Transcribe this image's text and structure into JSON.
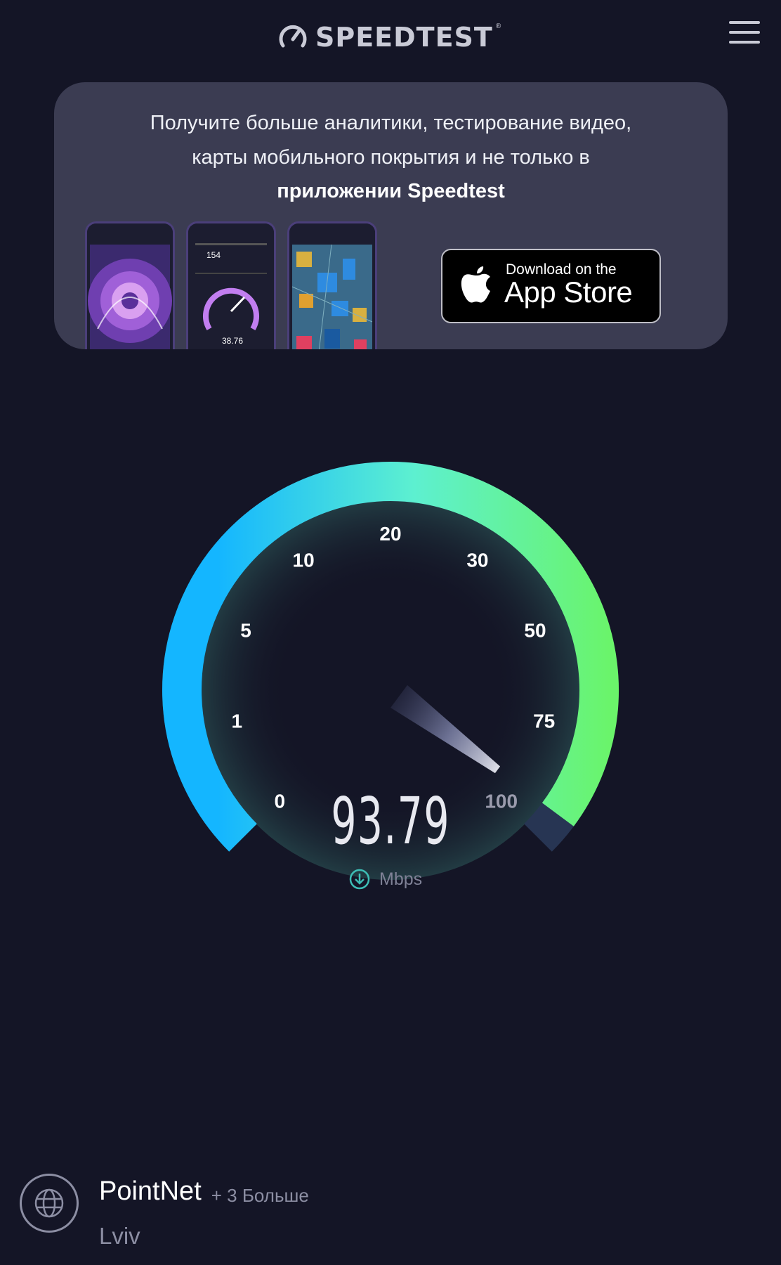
{
  "header": {
    "logo_text": "SPEEDTEST",
    "logo_tm": "®",
    "icons": {
      "logo": "speedometer-icon",
      "menu": "hamburger-menu-icon"
    }
  },
  "promo": {
    "line1": "Получите больше аналитики, тестирование видео,",
    "line2": "карты мобильного покрытия и не только в",
    "line3": "приложении Speedtest",
    "phone2_value_top": "154",
    "phone2_value_bottom": "38.76",
    "app_store": {
      "small": "Download on the",
      "big": "App Store",
      "icon": "apple-icon"
    }
  },
  "gauge": {
    "tick_labels": [
      "0",
      "1",
      "5",
      "10",
      "20",
      "30",
      "50",
      "75",
      "100"
    ],
    "current_value": 93.79,
    "value_text": "93.79",
    "unit": "Mbps",
    "unit_icon": "download-arrow-icon",
    "colors": {
      "start": "#14b6ff",
      "mid": "#5df0d0",
      "end": "#6af46a",
      "track": "#273553",
      "background": "#141526"
    }
  },
  "server": {
    "isp": "PointNet",
    "more": "+ 3 Больше",
    "city": "Lviv",
    "icon": "globe-icon"
  }
}
